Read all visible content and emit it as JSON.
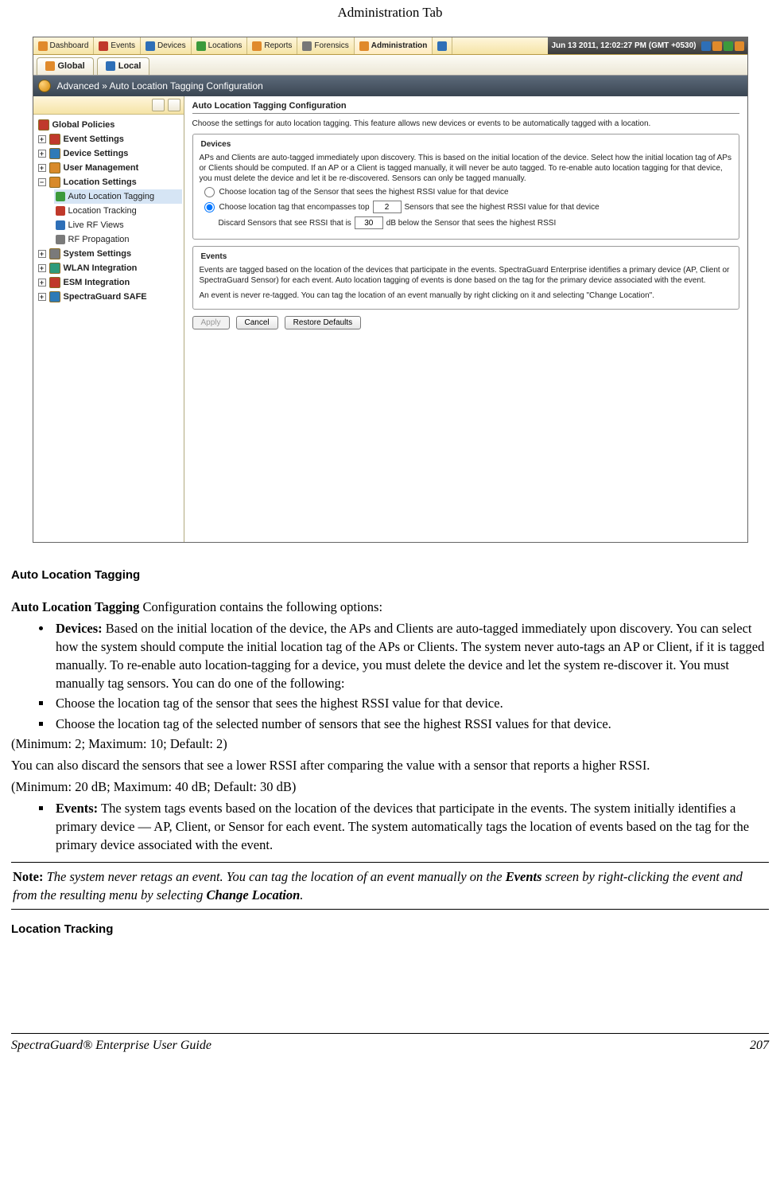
{
  "doc": {
    "header": "Administration Tab",
    "section1_title": "Auto Location Tagging",
    "intro_prefix_bold": "Auto Location Tagging",
    "intro_rest": " Configuration contains the following options:",
    "bullet1_lead": "Devices:",
    "bullet1_text": " Based on the initial location of the device, the APs and Clients are auto-tagged immediately upon discovery. You can select how the system should compute the initial location tag of the APs or Clients. The system never auto-tags an AP or Client, if it is tagged manually. To re-enable auto location-tagging for a device, you must delete the device and let the system re-discover it. You must manually tag sensors. You can do one of the following:",
    "sq1": "Choose the location tag of the sensor that sees the highest RSSI value for that device.",
    "sq2": "Choose the location tag of the selected number of sensors that see the highest RSSI values for that device.",
    "range1": "(Minimum: 2; Maximum: 10; Default: 2)",
    "discard_line": "You can also discard the sensors that see a lower RSSI after comparing the value with a sensor that reports a higher RSSI.",
    "range2": "(Minimum: 20 dB; Maximum: 40 dB; Default: 30 dB)",
    "bullet2_lead": "Events:",
    "bullet2_text": " The system tags events based on the location of the devices that participate in the events. The system initially identifies a primary device — AP, Client, or Sensor for each event. The system automatically tags the location of events based on the tag for the primary device associated with the event.",
    "note_lead": "Note:",
    "note_body_1": " The system never retags an event. You can tag the location of an event manually on the ",
    "note_bold1": "Events",
    "note_body_2": " screen by right-clicking the event and from the resulting menu by selecting ",
    "note_bold2": "Change Location",
    "note_body_3": ".",
    "section2_title": "Location Tracking",
    "footer_title": "SpectraGuard® Enterprise User Guide",
    "footer_page": "207"
  },
  "app": {
    "tabs": [
      "Dashboard",
      "Events",
      "Devices",
      "Locations",
      "Reports",
      "Forensics",
      "Administration"
    ],
    "selected_tab_index": 6,
    "status_text": "Jun 13 2011, 12:02:27 PM (GMT +0530)",
    "subtab_global": "Global",
    "subtab_local": "Local",
    "breadcrumb": "Advanced » Auto Location Tagging Configuration",
    "tree": {
      "root": "Global Policies",
      "nodes": [
        {
          "label": "Event Settings",
          "ico": "pol"
        },
        {
          "label": "Device Settings",
          "ico": "dev"
        },
        {
          "label": "User Management",
          "ico": "usr"
        },
        {
          "label": "Location Settings",
          "ico": "loc",
          "expanded": true,
          "children": [
            {
              "label": "Auto Location Tagging",
              "ico": "flag",
              "selected": true
            },
            {
              "label": "Location Tracking",
              "ico": "box"
            },
            {
              "label": "Live RF Views",
              "ico": "view"
            },
            {
              "label": "RF Propagation",
              "ico": "sig"
            }
          ]
        },
        {
          "label": "System Settings",
          "ico": "sys"
        },
        {
          "label": "WLAN Integration",
          "ico": "wlan"
        },
        {
          "label": "ESM Integration",
          "ico": "esm"
        },
        {
          "label": "SpectraGuard SAFE",
          "ico": "safe"
        }
      ]
    },
    "panel": {
      "title": "Auto Location Tagging Configuration",
      "desc": "Choose the settings for auto location tagging. This feature allows new devices or events to be automatically tagged with a location.",
      "devices_legend": "Devices",
      "devices_text": "APs and Clients are auto-tagged immediately upon discovery. This is based on the initial location of the device. Select how the initial location tag of APs or Clients should be computed. If an AP or a Client is tagged manually, it will never be auto tagged. To re-enable auto location tagging for that device, you must delete the device and let it be re-discovered. Sensors can only be tagged manually.",
      "radio1": "Choose location tag of the Sensor that sees the highest RSSI value for that device",
      "radio2a": "Choose location tag that encompasses top",
      "radio2_value": "2",
      "radio2b": "Sensors that see the highest RSSI value for that device",
      "discard_a": "Discard Sensors that see RSSI that is",
      "discard_value": "30",
      "discard_b": "dB below the Sensor that sees the highest RSSI",
      "events_legend": "Events",
      "events_text1": "Events are tagged based on the location of the devices that participate in the events. SpectraGuard Enterprise identifies a primary device (AP, Client or SpectraGuard Sensor) for each event. Auto location tagging of events is done based on the tag for the primary device associated with the event.",
      "events_text2": "An event is never re-tagged. You can tag the location of an event manually by right clicking on it and selecting \"Change Location\".",
      "btn_apply": "Apply",
      "btn_cancel": "Cancel",
      "btn_restore": "Restore Defaults"
    }
  }
}
